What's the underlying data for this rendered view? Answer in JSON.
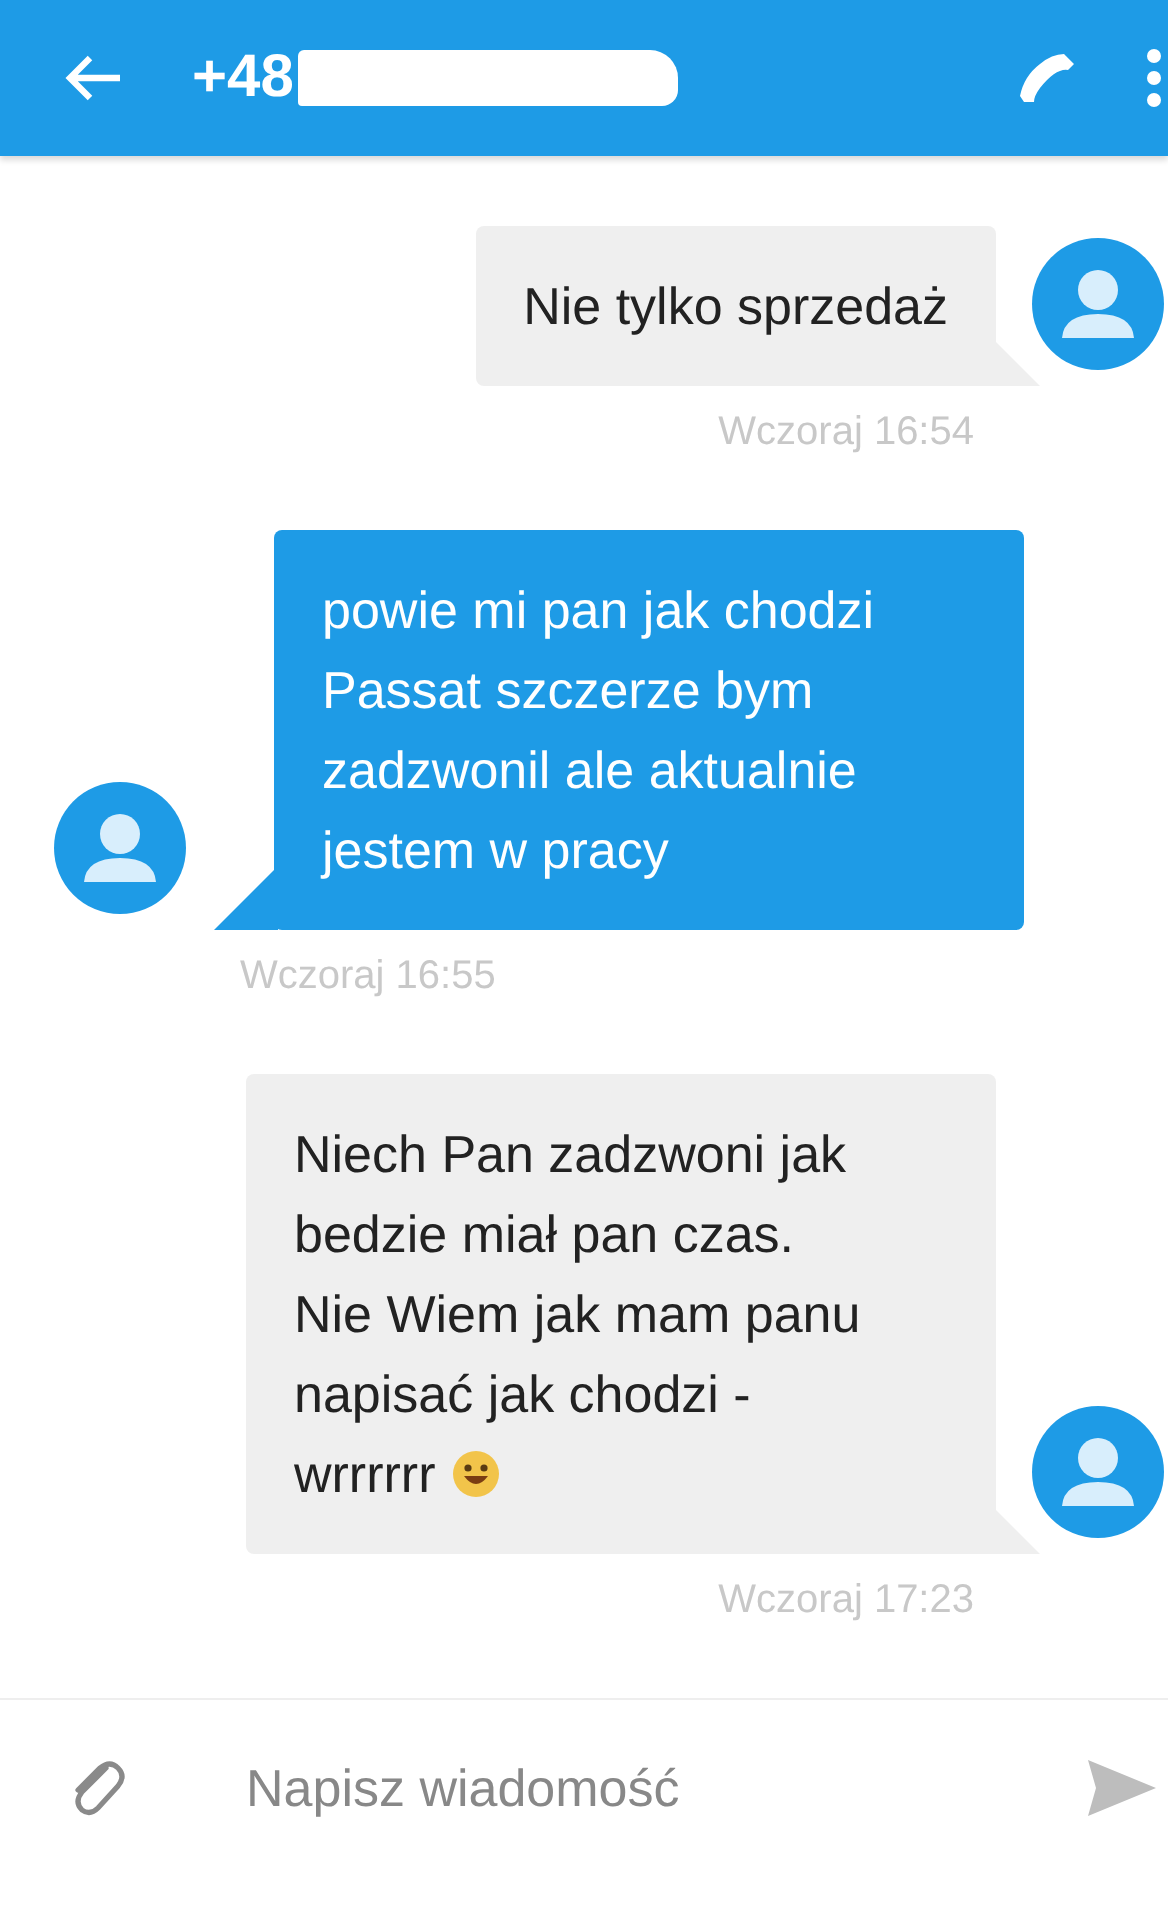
{
  "header": {
    "title": "+48",
    "number_hidden": true
  },
  "messages": [
    {
      "kind": "received",
      "text": "Nie tylko sprzedaż",
      "time": "Wczoraj 16:54",
      "emoji": false
    },
    {
      "kind": "sent",
      "text": "powie mi pan jak chodzi Passat szczerze bym zadzwonil ale aktualnie jestem w pracy",
      "time": "Wczoraj 16:55",
      "emoji": false
    },
    {
      "kind": "received",
      "text": "Niech Pan zadzwoni jak bedzie miał pan czas. Nie Wiem jak mam panu napisać jak chodzi - wrrrrrr",
      "time": "Wczoraj 17:23",
      "emoji": true
    }
  ],
  "composer": {
    "placeholder": "Napisz wiadomość"
  }
}
